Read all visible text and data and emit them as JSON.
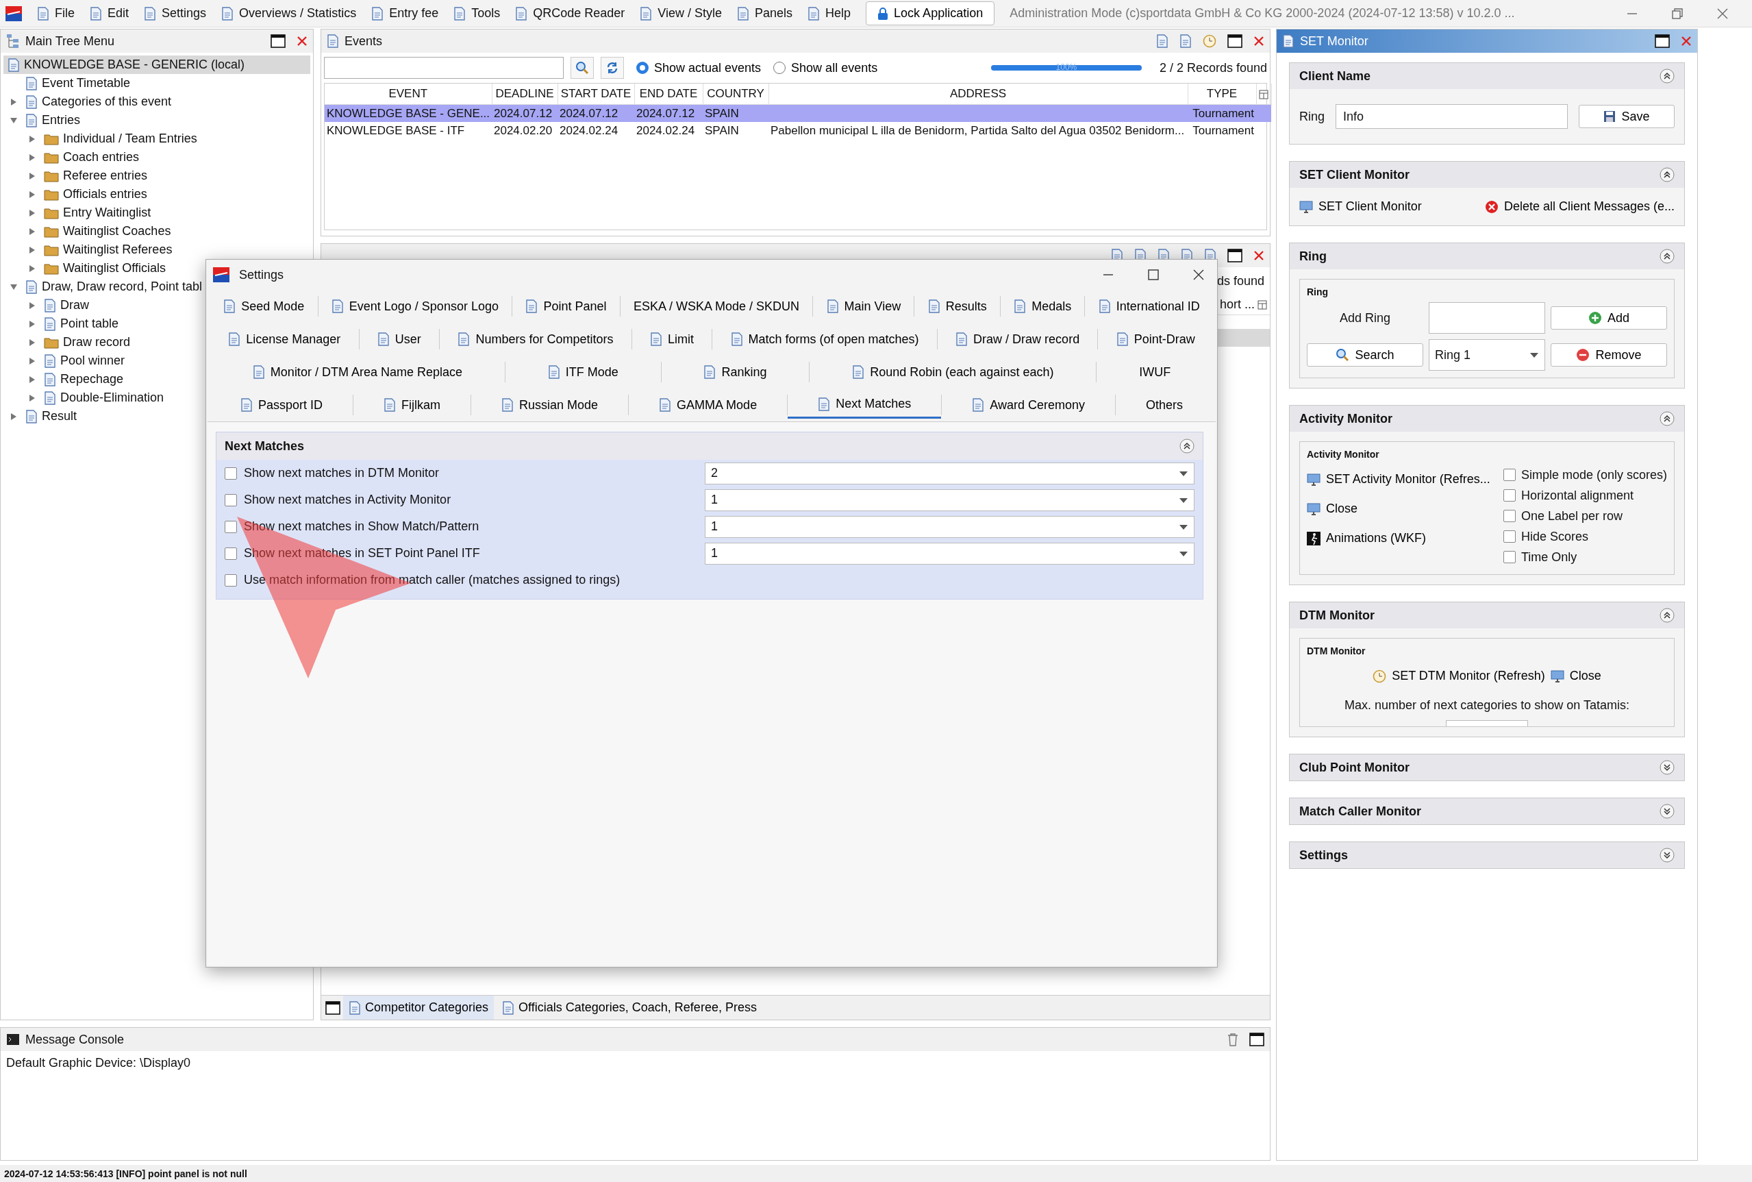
{
  "menu_bar": {
    "items": [
      "File",
      "Edit",
      "Settings",
      "Overviews / Statistics",
      "Entry fee",
      "Tools",
      "QRCode Reader",
      "View / Style",
      "Panels",
      "Help"
    ],
    "lock_button": "Lock Application",
    "title": "Administration Mode (c)sportdata GmbH & Co KG 2000-2024 (2024-07-12 13:58)  v 10.2.0 ..."
  },
  "main_tree": {
    "title": "Main Tree Menu",
    "items": [
      {
        "label": "KNOWLEDGE BASE - GENERIC (local)",
        "selected": true,
        "children": [
          {
            "label": "Event Timetable",
            "selected": false
          },
          {
            "label": "Categories of this event",
            "selected": false,
            "expanded": false
          },
          {
            "label": "Entries",
            "selected": false,
            "expanded": true,
            "children": [
              {
                "label": "Individual / Team Entries",
                "selected": false,
                "expanded": false
              },
              {
                "label": "Coach entries",
                "selected": false,
                "expanded": false
              },
              {
                "label": "Referee entries",
                "selected": false,
                "expanded": false
              },
              {
                "label": "Officials entries",
                "selected": false,
                "expanded": false
              },
              {
                "label": "Entry Waitinglist",
                "selected": false,
                "expanded": false
              },
              {
                "label": "Waitinglist Coaches",
                "selected": false,
                "expanded": false
              },
              {
                "label": "Waitinglist Referees",
                "selected": false,
                "expanded": false
              },
              {
                "label": "Waitinglist Officials",
                "selected": false,
                "expanded": false
              }
            ]
          },
          {
            "label": "Draw, Draw record, Point tabl",
            "selected": false,
            "expanded": true,
            "children": [
              {
                "label": "Draw",
                "selected": false,
                "expanded": false
              },
              {
                "label": "Point table",
                "selected": false,
                "expanded": false
              },
              {
                "label": "Draw record",
                "selected": false,
                "expanded": false
              },
              {
                "label": "Pool winner",
                "selected": false,
                "expanded": false
              },
              {
                "label": "Repechage",
                "selected": false,
                "expanded": false
              },
              {
                "label": "Double-Elimination",
                "selected": false,
                "expanded": false
              }
            ]
          },
          {
            "label": "Result",
            "selected": false,
            "expanded": false
          }
        ]
      }
    ]
  },
  "events": {
    "title": "Events",
    "filters": [
      {
        "label": "Show actual events",
        "selected": true
      },
      {
        "label": "Show all events",
        "selected": false
      }
    ],
    "progress": {
      "level": 1,
      "text": "100%"
    },
    "records": "2 / 2 Records found",
    "table": {
      "columns": [
        "EVENT",
        "DEADLINE",
        "START DATE",
        "END DATE",
        "COUNTRY",
        "ADDRESS",
        "TYPE"
      ],
      "rows": [
        {
          "selected": true,
          "cells": [
            "KNOWLEDGE BASE - GENE...",
            "2024.07.12",
            "2024.07.12",
            "2024.07.12",
            "SPAIN",
            "",
            "Tournament"
          ]
        },
        {
          "selected": false,
          "cells": [
            "KNOWLEDGE BASE - ITF",
            "2024.02.20",
            "2024.02.24",
            "2024.02.24",
            "SPAIN",
            "Pabellon municipal L illa de Benidorm, Partida Salto del Agua 03502 Benidorm...",
            "Tournament"
          ]
        }
      ]
    }
  },
  "categories_panel": {
    "records": "ds found",
    "column": "hort ...",
    "tabs": [
      {
        "label": "Competitor Categories",
        "selected": true
      },
      {
        "label": "Officials Categories, Coach, Referee, Press",
        "selected": false
      }
    ]
  },
  "settings_dialog": {
    "title": "Settings",
    "tab_rows": [
      [
        {
          "label": "Seed Mode",
          "kind": "icon",
          "selected": false
        },
        {
          "label": "Event Logo / Sponsor Logo",
          "kind": "icon",
          "selected": false
        },
        {
          "label": "Point Panel",
          "kind": "icon",
          "selected": false
        },
        {
          "label": "ESKA / WSKA Mode / SKDUN",
          "kind": "text",
          "selected": false
        },
        {
          "label": "Main View",
          "kind": "icon",
          "selected": false
        },
        {
          "label": "Results",
          "kind": "icon",
          "selected": false
        },
        {
          "label": "Medals",
          "kind": "icon",
          "selected": false
        },
        {
          "label": "International ID",
          "kind": "icon",
          "selected": false
        }
      ],
      [
        {
          "label": "License Manager",
          "kind": "icon",
          "selected": false
        },
        {
          "label": "User",
          "kind": "icon",
          "selected": false
        },
        {
          "label": "Numbers for Competitors",
          "kind": "icon",
          "selected": false
        },
        {
          "label": "Limit",
          "kind": "icon",
          "selected": false
        },
        {
          "label": "Match forms (of open matches)",
          "kind": "icon",
          "selected": false
        },
        {
          "label": "Draw / Draw record",
          "kind": "icon",
          "selected": false
        },
        {
          "label": "Point-Draw",
          "kind": "icon",
          "selected": false
        }
      ],
      [
        {
          "label": "Monitor / DTM Area Name Replace",
          "kind": "icon",
          "selected": false
        },
        {
          "label": "ITF Mode",
          "kind": "icon",
          "selected": false
        },
        {
          "label": "Ranking",
          "kind": "icon",
          "selected": false
        },
        {
          "label": "Round Robin (each against each)",
          "kind": "icon",
          "selected": false
        },
        {
          "label": "IWUF",
          "kind": "text",
          "selected": false
        }
      ],
      [
        {
          "label": "Passport ID",
          "kind": "icon",
          "selected": false
        },
        {
          "label": "Fijlkam",
          "kind": "icon",
          "selected": false
        },
        {
          "label": "Russian Mode",
          "kind": "icon",
          "selected": false
        },
        {
          "label": "GAMMA Mode",
          "kind": "icon",
          "selected": false
        },
        {
          "label": "Next Matches",
          "kind": "icon",
          "selected": true
        },
        {
          "label": "Award Ceremony",
          "kind": "icon",
          "selected": false
        },
        {
          "label": "Others",
          "kind": "text",
          "selected": false
        }
      ]
    ],
    "section": {
      "title": "Next Matches",
      "expanded": true,
      "rows": [
        {
          "label": "Show next matches in DTM Monitor",
          "checked": false,
          "value": "2"
        },
        {
          "label": "Show next matches in Activity Monitor",
          "checked": false,
          "value": "1"
        },
        {
          "label": "Show next matches in Show Match/Pattern",
          "checked": false,
          "value": "1"
        },
        {
          "label": "Show next matches in SET Point Panel ITF",
          "checked": false,
          "value": "1"
        },
        {
          "label": "Use match information from match caller (matches assigned to rings)",
          "checked": false
        }
      ]
    }
  },
  "console": {
    "title": "Message Console",
    "lines": [
      "Default Graphic Device: \\Display0"
    ]
  },
  "set_monitor": {
    "title": "SET Monitor",
    "sections": [
      {
        "kind": "client_name",
        "title": "Client Name",
        "expanded": true,
        "label": "Ring",
        "value": "Info",
        "button": "Save"
      },
      {
        "kind": "client_monitor",
        "title": "SET Client Monitor",
        "expanded": true,
        "actions": [
          "SET Client Monitor",
          "Delete all Client Messages (e..."
        ]
      },
      {
        "kind": "ring",
        "title": "Ring",
        "expanded": true,
        "group": "Ring",
        "add_label": "Add Ring",
        "add_button": "Add",
        "search_button": "Search",
        "ring_select": "Ring 1",
        "remove_button": "Remove"
      },
      {
        "kind": "activity",
        "title": "Activity Monitor",
        "expanded": true,
        "group": "Activity Monitor",
        "actions": [
          "SET Activity Monitor (Refres...",
          "Close",
          "Animations (WKF)"
        ],
        "options": [
          {
            "label": "Simple mode (only scores)",
            "checked": false
          },
          {
            "label": "Horizontal alignment",
            "checked": false
          },
          {
            "label": "One Label per row",
            "checked": false
          },
          {
            "label": "Hide Scores",
            "checked": false
          },
          {
            "label": "Time Only",
            "checked": false
          }
        ]
      },
      {
        "kind": "dtm",
        "title": "DTM Monitor",
        "expanded": true,
        "group": "DTM Monitor",
        "actions": [
          "SET DTM Monitor (Refresh)",
          "Close"
        ],
        "note": "Max. number of next categories to show on Tatamis:"
      },
      {
        "title": "Club Point Monitor",
        "expanded": false
      },
      {
        "title": "Match Caller Monitor",
        "expanded": false
      },
      {
        "title": "Settings",
        "expanded": false
      }
    ]
  },
  "status_bar": "2024-07-12 14:53:56:413 [INFO] point panel is not null"
}
